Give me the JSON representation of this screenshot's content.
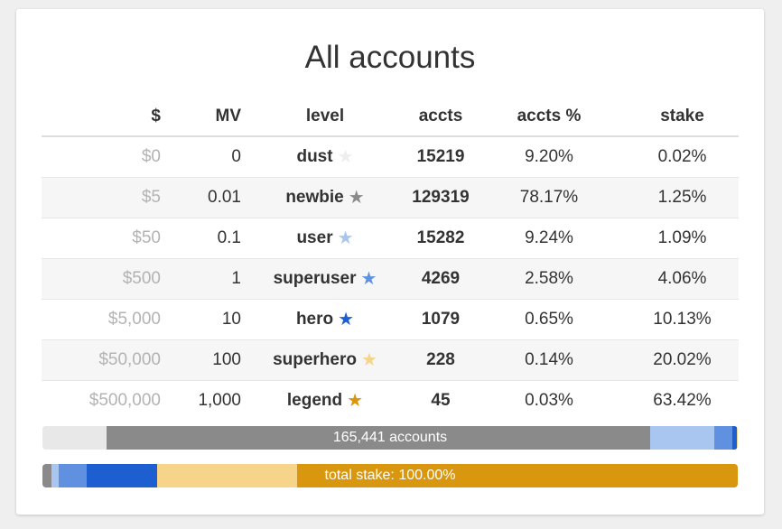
{
  "title": "All accounts",
  "columns": {
    "dollar": "$",
    "mv": "MV",
    "level": "level",
    "accts": "accts",
    "accts_pct": "accts %",
    "stake": "stake"
  },
  "rows": [
    {
      "dollar": "$0",
      "mv": "0",
      "level": "dust",
      "star_color": "#eeeeee",
      "accts": "15219",
      "accts_pct": "9.20%",
      "stake": "0.02%"
    },
    {
      "dollar": "$5",
      "mv": "0.01",
      "level": "newbie",
      "star_color": "#8a8a8a",
      "accts": "129319",
      "accts_pct": "78.17%",
      "stake": "1.25%"
    },
    {
      "dollar": "$50",
      "mv": "0.1",
      "level": "user",
      "star_color": "#a9c6f0",
      "accts": "15282",
      "accts_pct": "9.24%",
      "stake": "1.09%"
    },
    {
      "dollar": "$500",
      "mv": "1",
      "level": "superuser",
      "star_color": "#5f91e0",
      "accts": "4269",
      "accts_pct": "2.58%",
      "stake": "4.06%"
    },
    {
      "dollar": "$5,000",
      "mv": "10",
      "level": "hero",
      "star_color": "#1d5fd0",
      "accts": "1079",
      "accts_pct": "0.65%",
      "stake": "10.13%"
    },
    {
      "dollar": "$50,000",
      "mv": "100",
      "level": "superhero",
      "star_color": "#f6d58a",
      "accts": "228",
      "accts_pct": "0.14%",
      "stake": "20.02%"
    },
    {
      "dollar": "$500,000",
      "mv": "1,000",
      "level": "legend",
      "star_color": "#d9960f",
      "accts": "45",
      "accts_pct": "0.03%",
      "stake": "63.42%"
    }
  ],
  "accounts_bar": {
    "label": "165,441 accounts",
    "fractions": [
      0.092,
      0.7817,
      0.0924,
      0.0258,
      0.0065,
      0.0014,
      0.0003
    ]
  },
  "stake_bar": {
    "label": "total stake: 100.00%",
    "fractions": [
      0.0002,
      0.0125,
      0.0109,
      0.0406,
      0.1013,
      0.2002,
      0.6342
    ]
  },
  "level_colors": [
    "#e8e8e8",
    "#8a8a8a",
    "#a9c6f0",
    "#5f91e0",
    "#1d5fd0",
    "#f6d58a",
    "#d9960f"
  ],
  "star_glyph": "★"
}
